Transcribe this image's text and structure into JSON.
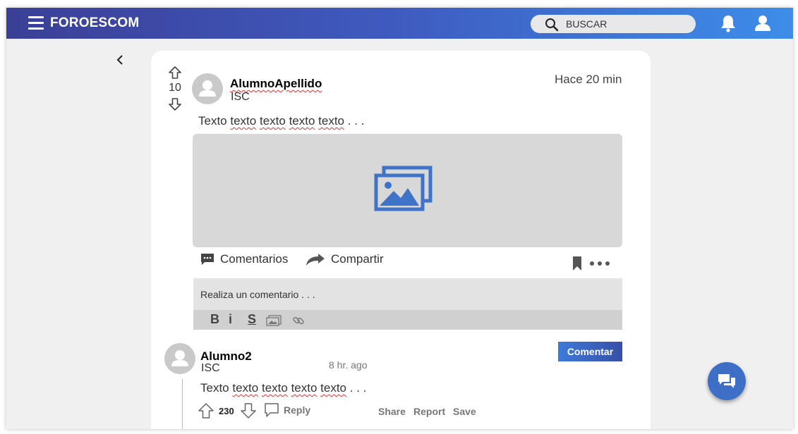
{
  "header": {
    "brand": "FOROESCOM",
    "search_placeholder": "BUSCAR"
  },
  "post": {
    "votes": "10",
    "author": "AlumnoApellido",
    "career": "ISC",
    "time": "Hace 20 min",
    "text_words": [
      "Texto",
      "texto",
      "texto",
      "texto",
      "texto",
      ". . ."
    ],
    "actions": {
      "comments": "Comentarios",
      "share": "Compartir"
    },
    "composer": {
      "placeholder": "Realiza un comentario . . .",
      "bold": "B",
      "italic": "i",
      "strike": "S",
      "submit": "Comentar"
    }
  },
  "comment": {
    "author": "Alumno2",
    "career": "ISC",
    "time": "8 hr. ago",
    "text_words": [
      "Texto",
      "texto",
      "texto",
      "texto",
      "texto",
      ". . ."
    ],
    "votes": "230",
    "reply": "Reply",
    "share": "Share",
    "report": "Report",
    "save": "Save"
  },
  "colors": {
    "header_gradient_start": "#3b3f96",
    "header_gradient_end": "#3d8de9",
    "accent": "#3e6fc6",
    "spellcheck": "#dd3333"
  },
  "icons": [
    "menu-icon",
    "search-icon",
    "bell-icon",
    "user-icon",
    "back-icon",
    "upvote-icon",
    "downvote-icon",
    "image-icon",
    "comment-icon",
    "share-icon",
    "bookmark-icon",
    "more-icon",
    "link-icon",
    "chat-icon"
  ]
}
